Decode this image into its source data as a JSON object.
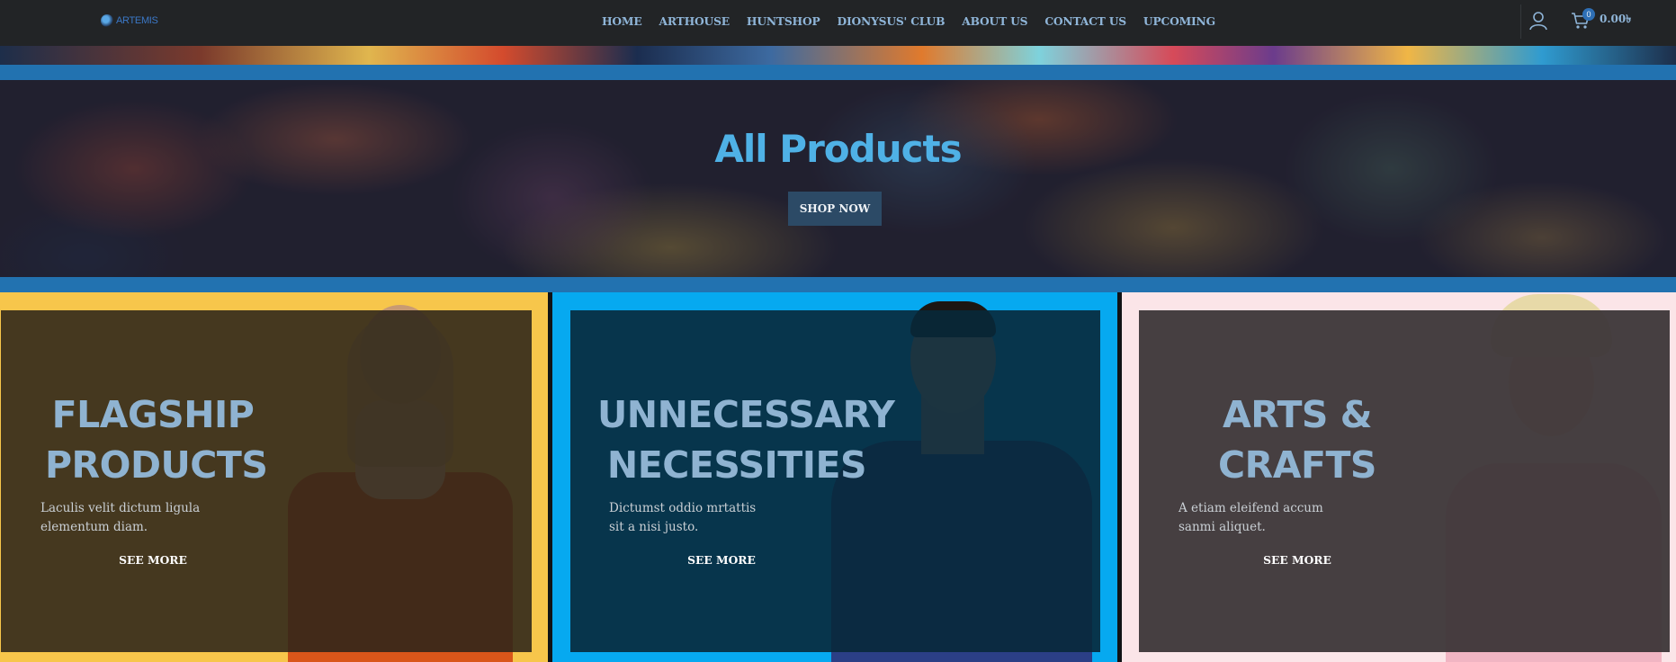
{
  "header": {
    "logo_text": "ARTEMIS",
    "nav": [
      "HOME",
      "ARTHOUSE",
      "HUNTSHOP",
      "DIONYSUS' CLUB",
      "ABOUT US",
      "CONTACT US",
      "UPCOMING"
    ],
    "cart_count": "0",
    "cart_total": "0.00৳"
  },
  "hero": {
    "title": "All Products",
    "button": "SHOP NOW"
  },
  "cards": [
    {
      "title_line1": "FLAGSHIP",
      "title_line2": "PRODUCTS",
      "desc_line1": "Laculis velit dictum ligula",
      "desc_line2": "elementum diam.",
      "link": "SEE MORE",
      "bg": "#f7c64b"
    },
    {
      "title_line1": "UNNECESSARY",
      "title_line2": "NECESSITIES",
      "desc_line1": "Dictumst oddio mrtattis",
      "desc_line2": "sit a nisi justo.",
      "link": "SEE MORE",
      "bg": "#06a9f0"
    },
    {
      "title_line1": "ARTS &",
      "title_line2": "CRAFTS",
      "desc_line1": "A etiam eleifend accum",
      "desc_line2": "sanmi aliquet.",
      "link": "SEE MORE",
      "bg": "#fbe5e8"
    }
  ],
  "colors": {
    "header_bg": "#222426",
    "nav_text": "#8fb5d8",
    "accent_band": "#2272b0",
    "hero_title": "#4fb1e6",
    "button_bg": "#2c4a66",
    "card_title": "#8fb3d1"
  },
  "icons": {
    "logo": "artemis-logo-icon",
    "account": "user-icon",
    "cart": "shopping-cart-icon"
  }
}
